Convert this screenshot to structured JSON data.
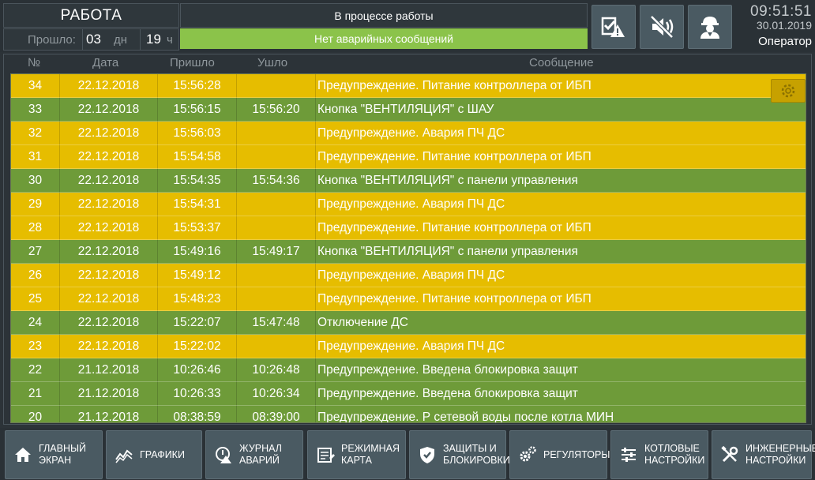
{
  "header": {
    "mode": "РАБОТА",
    "elapsed_label": "Прошло:",
    "elapsed_days": "03",
    "days_unit": "дн",
    "elapsed_hours": "19",
    "hours_unit": "ч",
    "status": "В процессе работы",
    "alarm_status": "Нет аварийных сообщений",
    "alarm_color": "#8bc34a",
    "buttons": [
      {
        "icon": "acknowledge-warning-icon"
      },
      {
        "icon": "sound-off-icon"
      },
      {
        "icon": "operator-icon"
      }
    ],
    "time": "09:51:51",
    "date": "30.01.2019",
    "user": "Оператор"
  },
  "table": {
    "columns": [
      "№",
      "Дата",
      "Пришло",
      "Ушло",
      "Сообщение"
    ],
    "rows": [
      {
        "n": "34",
        "date": "22.12.2018",
        "in": "15:56:28",
        "out": "",
        "msg": "Предупреждение. Питание контроллера от ИБП",
        "type": "warn"
      },
      {
        "n": "33",
        "date": "22.12.2018",
        "in": "15:56:15",
        "out": "15:56:20",
        "msg": "Кнопка \"ВЕНТИЛЯЦИЯ\" с ШАУ",
        "type": "ok"
      },
      {
        "n": "32",
        "date": "22.12.2018",
        "in": "15:56:03",
        "out": "",
        "msg": "Предупреждение. Авария ПЧ ДС",
        "type": "warn"
      },
      {
        "n": "31",
        "date": "22.12.2018",
        "in": "15:54:58",
        "out": "",
        "msg": "Предупреждение. Питание контроллера от ИБП",
        "type": "warn"
      },
      {
        "n": "30",
        "date": "22.12.2018",
        "in": "15:54:35",
        "out": "15:54:36",
        "msg": "Кнопка \"ВЕНТИЛЯЦИЯ\" с панели управления",
        "type": "ok"
      },
      {
        "n": "29",
        "date": "22.12.2018",
        "in": "15:54:31",
        "out": "",
        "msg": "Предупреждение. Авария ПЧ ДС",
        "type": "warn"
      },
      {
        "n": "28",
        "date": "22.12.2018",
        "in": "15:53:37",
        "out": "",
        "msg": "Предупреждение. Питание контроллера от ИБП",
        "type": "warn"
      },
      {
        "n": "27",
        "date": "22.12.2018",
        "in": "15:49:16",
        "out": "15:49:17",
        "msg": "Кнопка \"ВЕНТИЛЯЦИЯ\" с панели управления",
        "type": "ok"
      },
      {
        "n": "26",
        "date": "22.12.2018",
        "in": "15:49:12",
        "out": "",
        "msg": "Предупреждение. Авария ПЧ ДС",
        "type": "warn"
      },
      {
        "n": "25",
        "date": "22.12.2018",
        "in": "15:48:23",
        "out": "",
        "msg": "Предупреждение. Питание контроллера от ИБП",
        "type": "warn"
      },
      {
        "n": "24",
        "date": "22.12.2018",
        "in": "15:22:07",
        "out": "15:47:48",
        "msg": "Отключение ДС",
        "type": "ok"
      },
      {
        "n": "23",
        "date": "22.12.2018",
        "in": "15:22:02",
        "out": "",
        "msg": "Предупреждение. Авария ПЧ ДС",
        "type": "warn"
      },
      {
        "n": "22",
        "date": "21.12.2018",
        "in": "10:26:46",
        "out": "10:26:48",
        "msg": "Предупреждение. Введена блокировка защит",
        "type": "ok"
      },
      {
        "n": "21",
        "date": "21.12.2018",
        "in": "10:26:33",
        "out": "10:26:34",
        "msg": "Предупреждение. Введена блокировка защит",
        "type": "ok"
      },
      {
        "n": "20",
        "date": "21.12.2018",
        "in": "08:38:59",
        "out": "08:39:00",
        "msg": "Предупреждение. Р сетевой воды после котла МИН",
        "type": "ok"
      }
    ],
    "colors": {
      "warn": "#e6bd00",
      "ok": "#6e9b39"
    },
    "settings_icon": "gear-icon"
  },
  "nav": [
    {
      "label": "ГЛАВНЫЙ\nЭКРАН",
      "icon": "home-icon"
    },
    {
      "label": "ГРАФИКИ",
      "icon": "chart-icon"
    },
    {
      "label": "ЖУРНАЛ\nАВАРИЙ",
      "icon": "alarm-log-icon"
    },
    {
      "label": "РЕЖИМНАЯ\nКАРТА",
      "icon": "mode-card-icon"
    },
    {
      "label": "ЗАЩИТЫ И\nБЛОКИРОВКИ",
      "icon": "shield-icon"
    },
    {
      "label": "РЕГУЛЯТОРЫ",
      "icon": "gears-icon"
    },
    {
      "label": "КОТЛОВЫЕ\nНАСТРОЙКИ",
      "icon": "sliders-icon"
    },
    {
      "label": "ИНЖЕНЕРНЫЕ\nНАСТРОЙКИ",
      "icon": "tools-icon"
    }
  ]
}
